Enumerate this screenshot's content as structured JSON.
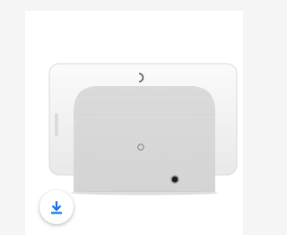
{
  "download": {
    "icon": "download-icon",
    "accent_color": "#1a73e8"
  },
  "product": {
    "image_icon": "smart-display-image",
    "speaker_color": "#d9d9d9",
    "screen_color": "#f0f0f0"
  }
}
